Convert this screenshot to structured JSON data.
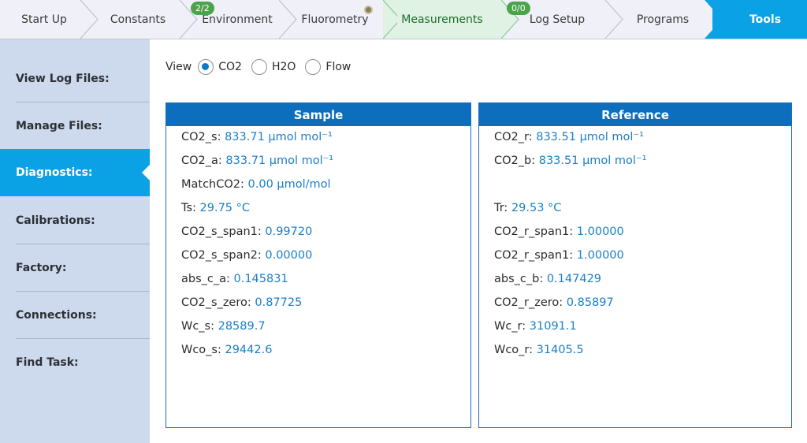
{
  "tabs": [
    {
      "label": "Start Up"
    },
    {
      "label": "Constants"
    },
    {
      "label": "Environment",
      "badge": "2/2"
    },
    {
      "label": "Fluorometry"
    },
    {
      "label": "Measurements"
    },
    {
      "label": "Log Setup",
      "badge": "0/0"
    },
    {
      "label": "Programs"
    },
    {
      "label": "Tools"
    }
  ],
  "sidebar": {
    "items": [
      {
        "label": "View Log Files:"
      },
      {
        "label": "Manage Files:"
      },
      {
        "label": "Diagnostics:"
      },
      {
        "label": "Calibrations:"
      },
      {
        "label": "Factory:"
      },
      {
        "label": "Connections:"
      },
      {
        "label": "Find Task:"
      }
    ],
    "active_index": 2
  },
  "view": {
    "label": "View",
    "options": [
      {
        "label": "CO2",
        "selected": true
      },
      {
        "label": "H2O",
        "selected": false
      },
      {
        "label": "Flow",
        "selected": false
      }
    ]
  },
  "sample": {
    "title": "Sample",
    "rows": [
      {
        "label": "CO2_s:",
        "value": "833.71 µmol mol⁻¹"
      },
      {
        "label": "CO2_a:",
        "value": "833.71 µmol mol⁻¹"
      },
      {
        "label": "MatchCO2:",
        "value": "0.00 µmol/mol"
      },
      {
        "label": "Ts:",
        "value": "29.75 °C"
      },
      {
        "label": "CO2_s_span1:",
        "value": "0.99720"
      },
      {
        "label": "CO2_s_span2:",
        "value": "0.00000"
      },
      {
        "label": "abs_c_a:",
        "value": "0.145831"
      },
      {
        "label": "CO2_s_zero:",
        "value": "0.87725"
      },
      {
        "label": "Wc_s:",
        "value": "28589.7"
      },
      {
        "label": "Wco_s:",
        "value": "29442.6"
      }
    ]
  },
  "reference": {
    "title": "Reference",
    "rows": [
      {
        "label": "CO2_r:",
        "value": "833.51 µmol mol⁻¹"
      },
      {
        "label": "CO2_b:",
        "value": "833.51 µmol mol⁻¹"
      },
      {
        "label": "Tr:",
        "value": "29.53 °C"
      },
      {
        "label": "CO2_r_span1:",
        "value": "1.00000"
      },
      {
        "label": "CO2_r_span1:",
        "value": "1.00000"
      },
      {
        "label": "abs_c_b:",
        "value": "0.147429"
      },
      {
        "label": "CO2_r_zero:",
        "value": "0.85897"
      },
      {
        "label": "Wc_r:",
        "value": "31091.1"
      },
      {
        "label": "Wco_r:",
        "value": "31405.5"
      }
    ]
  },
  "colors": {
    "accent": "#0aa2e4",
    "panel_header": "#0c6ebd",
    "value_text": "#1a7fc8",
    "tab_active_bg": "#dff2e4",
    "sidebar_bg": "#cdd9ec",
    "badge": "#4aa44a"
  },
  "icons": {
    "fluorometry_status": "status-dot-icon",
    "active_item_pointer": "pointer-arrow-icon"
  }
}
